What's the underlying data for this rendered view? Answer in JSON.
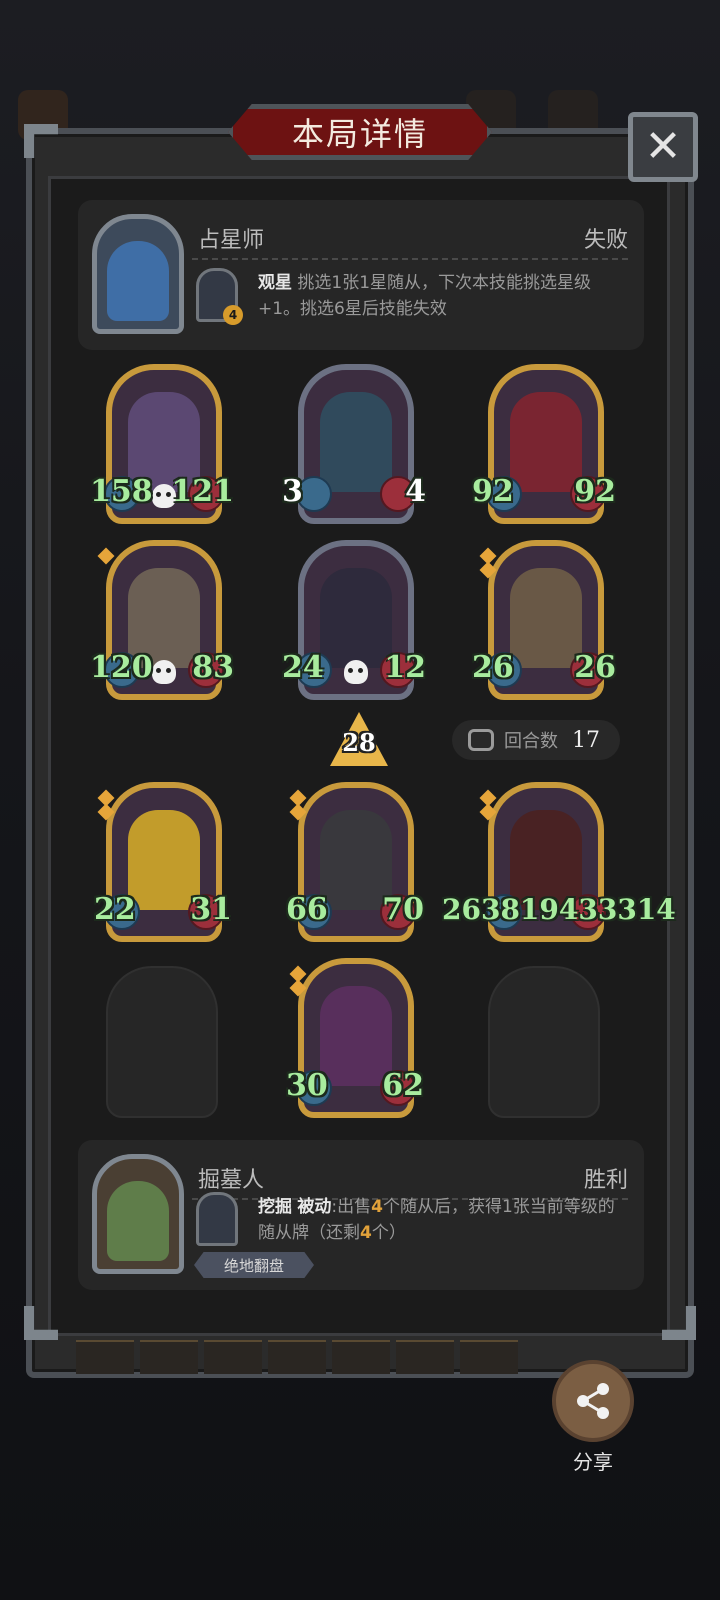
{
  "dialog": {
    "title": "本局详情",
    "close_symbol": "✕"
  },
  "opponent": {
    "hero_name": "占星师",
    "result": "失败",
    "skill_level": "4",
    "skill_name": "观星",
    "skill_desc": " 挑选1张1星随从，下次本技能挑选星级+1。挑选6星后技能失效"
  },
  "board_top": [
    {
      "atk": "158",
      "hp": "121",
      "skull": true,
      "frame": "gold",
      "stars": 0,
      "hp_white": false,
      "atk_white": false
    },
    {
      "atk": "3",
      "hp": "4",
      "skull": false,
      "frame": "silver",
      "stars": 0,
      "hp_white": true,
      "atk_white": true
    },
    {
      "atk": "92",
      "hp": "92",
      "skull": false,
      "frame": "gold",
      "stars": 0,
      "hp_white": false,
      "atk_white": false
    },
    {
      "atk": "120",
      "hp": "83",
      "skull": true,
      "frame": "gold",
      "stars": 1,
      "hp_white": false,
      "atk_white": false
    },
    {
      "atk": "24",
      "hp": "12",
      "skull": true,
      "frame": "silver",
      "stars": 0,
      "hp_white": false,
      "atk_white": false
    },
    {
      "atk": "26",
      "hp": "26",
      "skull": false,
      "frame": "gold",
      "stars": 2,
      "hp_white": false,
      "atk_white": false
    }
  ],
  "tier": "28",
  "rounds": {
    "label": "回合数",
    "value": "17"
  },
  "board_bottom": [
    {
      "atk": "22",
      "hp": "31",
      "frame": "gold",
      "stars": 2
    },
    {
      "atk": "66",
      "hp": "70",
      "frame": "gold",
      "stars": 2
    },
    {
      "atk": "26381",
      "hp": "94",
      "hp_full": "3314",
      "frame": "gold",
      "stars": 2
    },
    {
      "atk": "30",
      "hp": "62",
      "frame": "gold",
      "stars": 2
    }
  ],
  "big_stat_text": "263819433314",
  "player": {
    "hero_name": "掘墓人",
    "result": "胜利",
    "skill_name": "挖掘",
    "skill_type": "被动",
    "skill_desc_pre": ":出售",
    "count1": "4",
    "skill_desc_mid": "个随从后，获得1张当前等级的随从牌（还剩",
    "count2": "4",
    "skill_desc_end": "个）",
    "tag": "绝地翻盘"
  },
  "share_label": "分享",
  "colors": {
    "panel": "#2b2b2b",
    "title_red": "#6d1212",
    "stat_green": "#a8ec9e",
    "gold_frame": "#c89a3c",
    "silver_frame": "#6c7183",
    "accent_orange": "#e2a23a"
  }
}
